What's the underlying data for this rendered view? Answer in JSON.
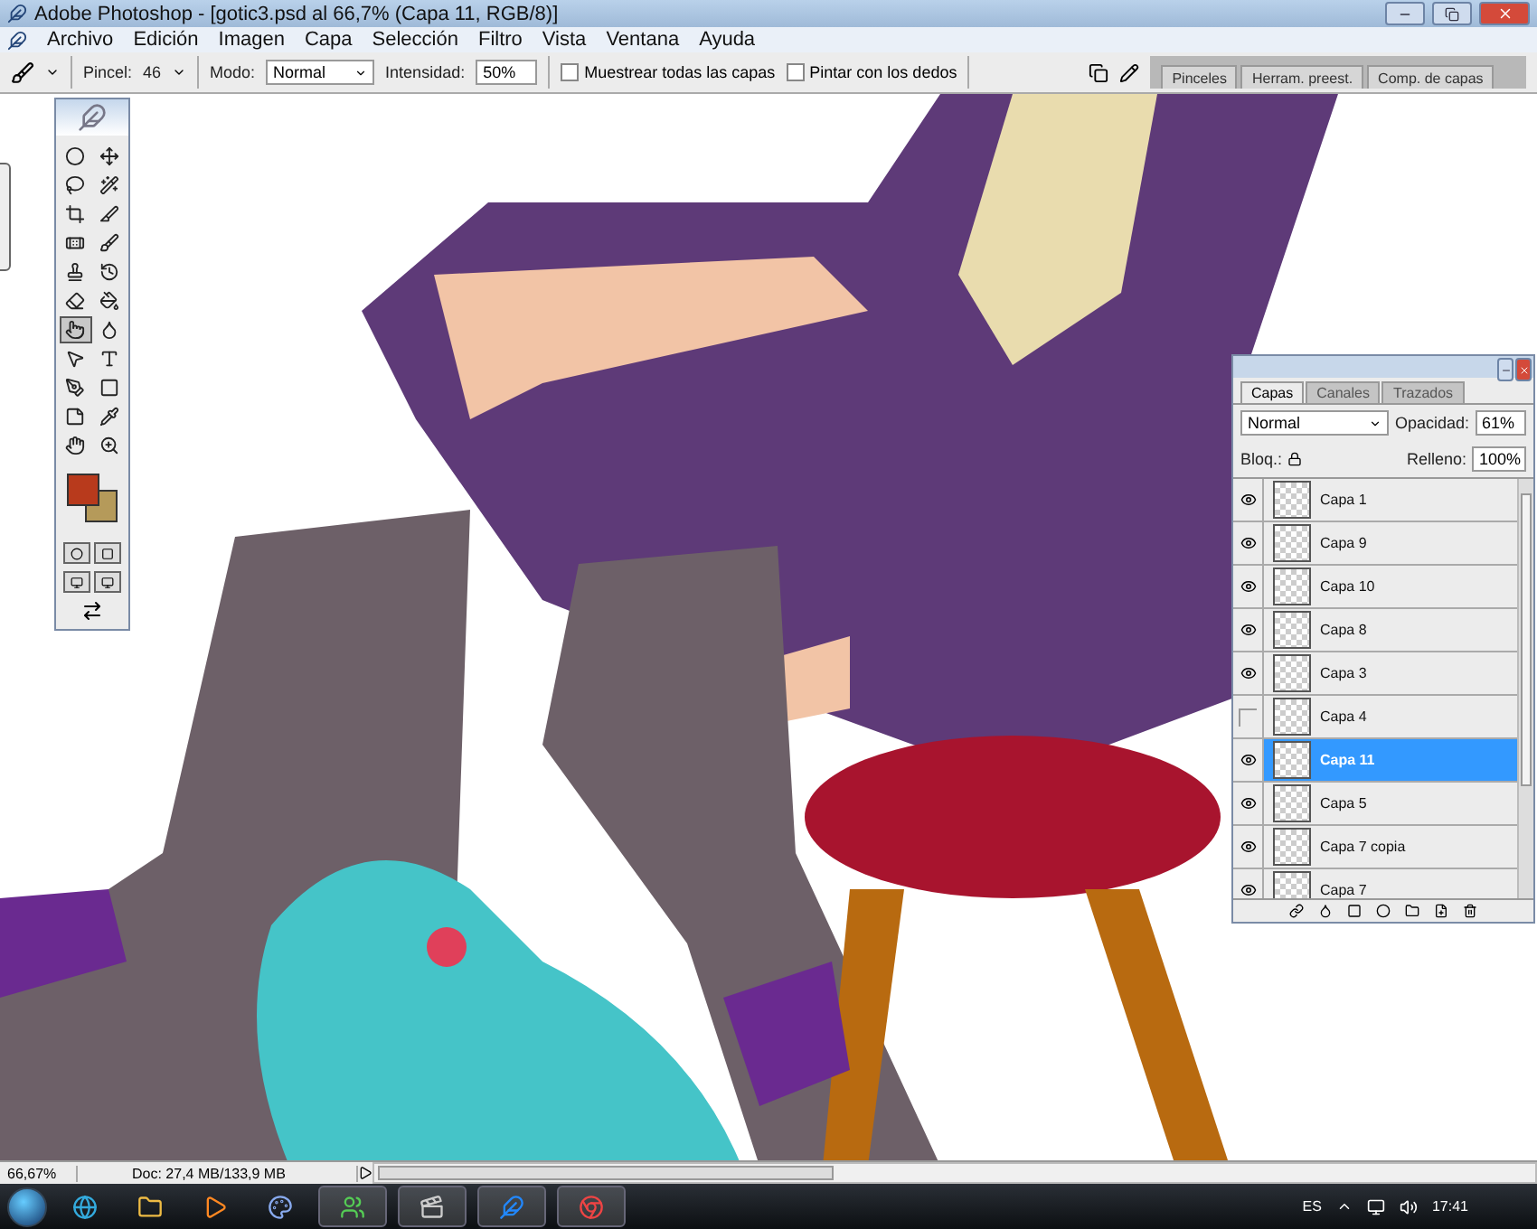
{
  "window": {
    "title": "Adobe Photoshop - [gotic3.psd al 66,7% (Capa 11, RGB/8)]"
  },
  "menu": [
    "Archivo",
    "Edición",
    "Imagen",
    "Capa",
    "Selección",
    "Filtro",
    "Vista",
    "Ventana",
    "Ayuda"
  ],
  "options": {
    "brush_label": "Pincel:",
    "brush_size": "46",
    "mode_label": "Modo:",
    "mode": "Normal",
    "strength_label": "Intensidad:",
    "strength": "50%",
    "checkboxes": [
      {
        "label": "Muestrear todas las capas",
        "checked": false
      },
      {
        "label": "Pintar con los dedos",
        "checked": false
      }
    ],
    "palette_tabs": [
      "Pinceles",
      "Herram. preest.",
      "Comp. de capas"
    ]
  },
  "tools": [
    {
      "kind": "marquee",
      "selected": false
    },
    {
      "kind": "move",
      "selected": false
    },
    {
      "kind": "lasso",
      "selected": false
    },
    {
      "kind": "wand",
      "selected": false
    },
    {
      "kind": "crop",
      "selected": false
    },
    {
      "kind": "slice",
      "selected": false
    },
    {
      "kind": "heal",
      "selected": false
    },
    {
      "kind": "brush",
      "selected": false
    },
    {
      "kind": "stamp",
      "selected": false
    },
    {
      "kind": "history",
      "selected": false
    },
    {
      "kind": "eraser",
      "selected": false
    },
    {
      "kind": "bucket",
      "selected": false
    },
    {
      "kind": "smudge",
      "selected": true
    },
    {
      "kind": "dodge",
      "selected": false
    },
    {
      "kind": "select",
      "selected": false
    },
    {
      "kind": "type",
      "selected": false
    },
    {
      "kind": "pen",
      "selected": false
    },
    {
      "kind": "shape",
      "selected": false
    },
    {
      "kind": "notes",
      "selected": false
    },
    {
      "kind": "eyedropper",
      "selected": false
    },
    {
      "kind": "hand",
      "selected": false
    },
    {
      "kind": "zoom",
      "selected": false
    }
  ],
  "layers_panel": {
    "tabs": [
      {
        "label": "Capas",
        "selected": true
      },
      {
        "label": "Canales",
        "selected": false
      },
      {
        "label": "Trazados",
        "selected": false
      }
    ],
    "blend": "Normal",
    "opacity_label": "Opacidad:",
    "opacity": "61%",
    "lock_label": "Bloq.:",
    "fill_label": "Relleno:",
    "fill": "100%",
    "layers": [
      {
        "name": "Capa 1",
        "visible": true,
        "selected": false
      },
      {
        "name": "Capa 9",
        "visible": true,
        "selected": false
      },
      {
        "name": "Capa 10",
        "visible": true,
        "selected": false
      },
      {
        "name": "Capa 8",
        "visible": true,
        "selected": false
      },
      {
        "name": "Capa 3",
        "visible": true,
        "selected": false
      },
      {
        "name": "Capa 4",
        "visible": false,
        "selected": false
      },
      {
        "name": "Capa 11",
        "visible": true,
        "selected": true
      },
      {
        "name": "Capa 5",
        "visible": true,
        "selected": false
      },
      {
        "name": "Capa 7 copia",
        "visible": true,
        "selected": false
      },
      {
        "name": "Capa 7",
        "visible": true,
        "selected": false
      }
    ]
  },
  "status_bar": {
    "zoom": "66,67%",
    "doc": "Doc: 27,4 MB/133,9 MB"
  },
  "taskbar": {
    "apps": [
      {
        "kind": "browser",
        "running": false
      },
      {
        "kind": "folder",
        "running": false
      },
      {
        "kind": "media",
        "running": false
      },
      {
        "kind": "paint",
        "running": false
      },
      {
        "kind": "messenger",
        "running": true
      },
      {
        "kind": "video",
        "running": true
      },
      {
        "kind": "feather",
        "running": true
      },
      {
        "kind": "chrome",
        "running": true
      }
    ],
    "language": "ES",
    "time": "17:41"
  }
}
